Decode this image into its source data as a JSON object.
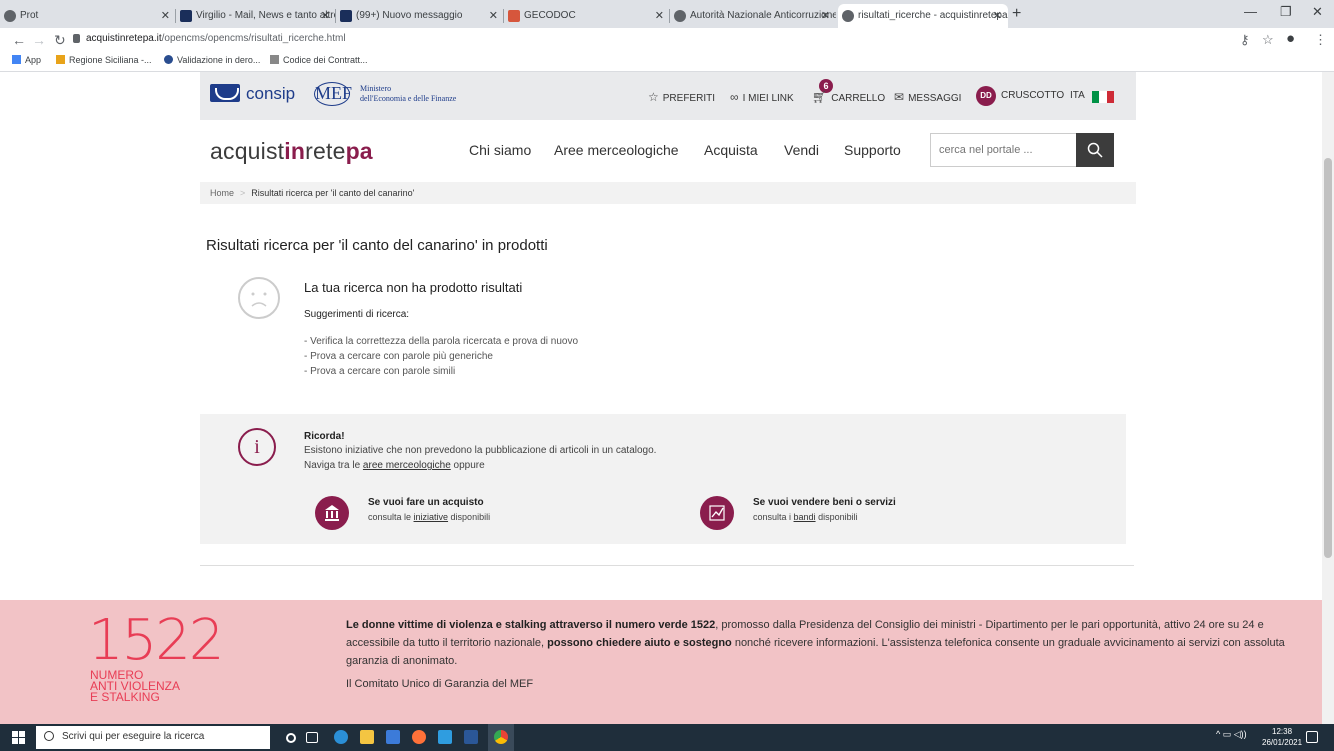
{
  "browser": {
    "tabs": [
      {
        "label": "Prot"
      },
      {
        "label": "Virgilio - Mail, News e tanto altro"
      },
      {
        "label": "(99+) Nuovo messaggio"
      },
      {
        "label": "GECODOC"
      },
      {
        "label": "Autorità Nazionale Anticorruzione"
      },
      {
        "label": "risultati_ricerche - acquistinretepa"
      }
    ],
    "url_host": "acquistinretepa.it",
    "url_path": "/opencms/opencms/risultati_ricerche.html",
    "bookmarks": [
      {
        "label": "App"
      },
      {
        "label": "Regione Siciliana -..."
      },
      {
        "label": "Validazione in dero..."
      },
      {
        "label": "Codice dei Contratt..."
      }
    ]
  },
  "header": {
    "consip": "consip",
    "mef": "MEF",
    "mef_line1": "Ministero",
    "mef_line2": "dell'Economia e delle Finanze",
    "util": {
      "preferiti": "PREFERITI",
      "link": "I MIEI LINK",
      "cart_count": "6",
      "carrello": "CARRELLO",
      "messaggi": "MESSAGGI",
      "avatar": "DD",
      "cruscotto": "CRUSCOTTO",
      "lang": "ITA"
    },
    "flag_colors": [
      "#009246",
      "#ffffff",
      "#ce2b37"
    ]
  },
  "nav": {
    "brand": {
      "p1": "acquist",
      "p2": "in",
      "p3": "rete",
      "p4": "pa"
    },
    "items": [
      "Chi siamo",
      "Aree merceologiche",
      "Acquista",
      "Vendi",
      "Supporto"
    ],
    "search_placeholder": "cerca nel portale ..."
  },
  "breadcrumb": {
    "home": "Home",
    "separator": ">",
    "current": "Risultati ricerca per 'il canto del canarino'"
  },
  "results": {
    "title": "Risultati ricerca per 'il canto del canarino' in prodotti",
    "no_results": "La tua ricerca non ha prodotto risultati",
    "suggestions_title": "Suggerimenti di ricerca:",
    "suggestions": [
      "- Verifica la correttezza della parola ricercata e prova di nuovo",
      "- Prova a cercare con parole più generiche",
      "- Prova a cercare con parole simili"
    ]
  },
  "info": {
    "title": "Ricorda!",
    "line1": "Esistono iniziative che non prevedono la pubblicazione di articoli in un catalogo.",
    "line2_pre": "Naviga tra le ",
    "line2_link": "aree merceologiche",
    "line2_post": " oppure",
    "buy_title": "Se vuoi fare un acquisto",
    "buy_pre": "consulta le ",
    "buy_link": "iniziative",
    "buy_post": " disponibili",
    "sell_title": "Se vuoi vendere beni o servizi",
    "sell_pre": "consulta i ",
    "sell_link": "bandi",
    "sell_post": " disponibili"
  },
  "footer": {
    "number": "1522",
    "sub1": "NUMERO",
    "sub2": "ANTI VIOLENZA",
    "sub3": "E STALKING",
    "text_b1": "Le donne vittime di violenza e stalking attraverso il numero verde 1522",
    "text_1": ", promosso dalla Presidenza del Consiglio dei ministri - Dipartimento per le pari opportunità, attivo 24 ore su 24 e accessibile da tutto il territorio nazionale, ",
    "text_b2": "possono chiedere aiuto e sostegno",
    "text_2": " nonché ricevere informazioni. L'assistenza telefonica consente un graduale avvicinamento ai servizi con assoluta garanzia di anonimato.",
    "link": "Il Comitato Unico di Garanzia del MEF"
  },
  "taskbar": {
    "search_placeholder": "Scrivi qui per eseguire la ricerca",
    "time": "12:38",
    "date": "26/01/2021"
  },
  "colors": {
    "accent": "#8a1d4d",
    "footer_bg": "#f2c3c6",
    "footer_accent": "#e83d55"
  }
}
